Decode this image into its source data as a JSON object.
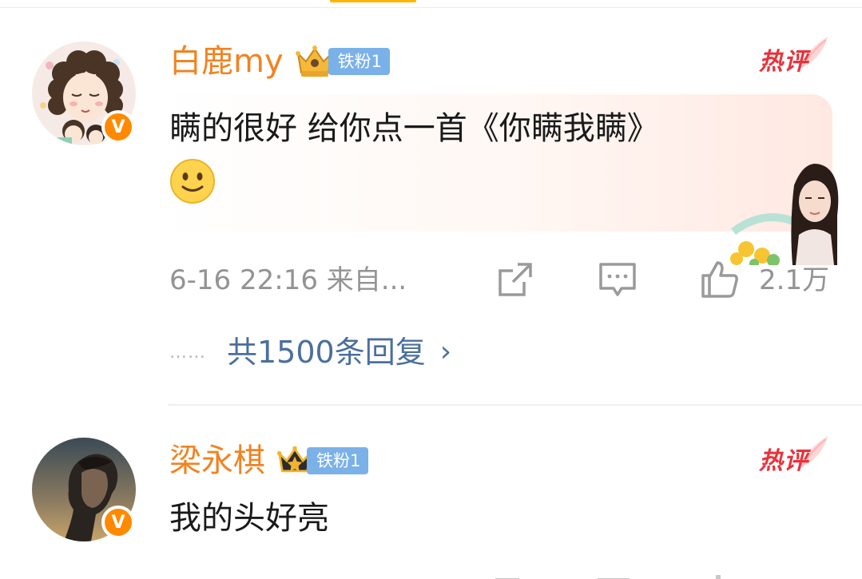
{
  "comments": [
    {
      "username": "白鹿my",
      "fan_badge": "铁粉1",
      "verified_badge": "V",
      "hot_tag": "热评",
      "text": "瞒的很好 给你点一首《你瞒我瞒》",
      "emoji": "slightly-smiling-face",
      "timestamp": "6-16 22:16  来自...",
      "like_count": "2.1万",
      "replies_label": "共1500条回复",
      "replies_dots": "……",
      "chevron": "›"
    },
    {
      "username": "梁永棋",
      "fan_badge": "铁粉1",
      "verified_badge": "V",
      "hot_tag": "热评",
      "text": "我的头好亮"
    }
  ],
  "colors": {
    "username": "#f08322",
    "fan_badge_bg": "#7ab1e8",
    "hot_tag": "#e8323c",
    "link": "#4b6f9d",
    "meta": "#939393",
    "verified": "#ff8a00"
  },
  "icons": [
    "share-icon",
    "comment-icon",
    "like-icon",
    "crown-icon",
    "hot-feather-icon",
    "verified-v-icon"
  ]
}
